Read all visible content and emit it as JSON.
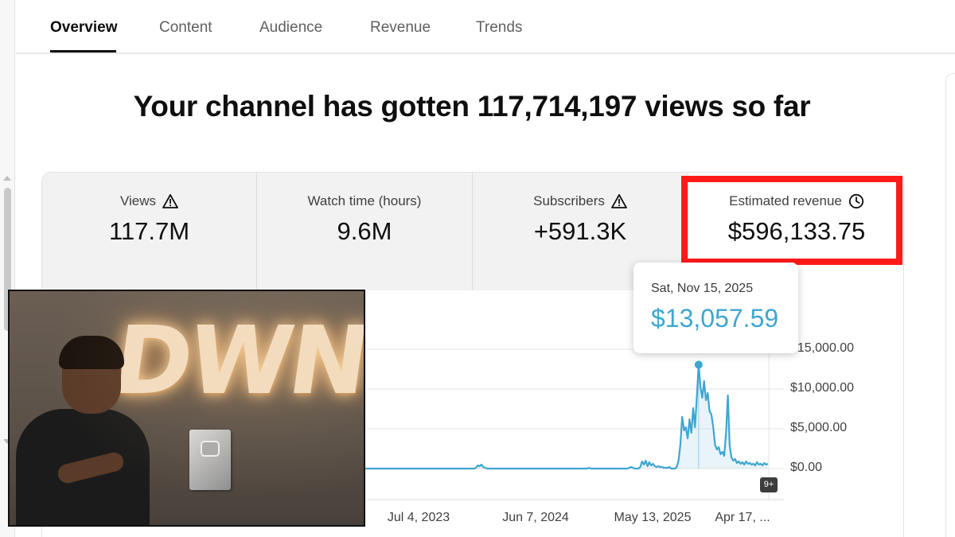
{
  "tabs": [
    {
      "label": "Overview",
      "active": true
    },
    {
      "label": "Content",
      "active": false
    },
    {
      "label": "Audience",
      "active": false
    },
    {
      "label": "Revenue",
      "active": false
    },
    {
      "label": "Trends",
      "active": false
    }
  ],
  "headline": "Your channel has gotten 117,714,197 views so far",
  "metrics": [
    {
      "label": "Views",
      "value": "117.7M",
      "icon": "warning-icon"
    },
    {
      "label": "Watch time (hours)",
      "value": "9.6M",
      "icon": ""
    },
    {
      "label": "Subscribers",
      "value": "+591.3K",
      "icon": "warning-icon"
    },
    {
      "label": "Estimated revenue",
      "value": "$596,133.75",
      "icon": "clock-icon",
      "selected": true
    }
  ],
  "tooltip": {
    "date": "Sat, Nov 15, 2025",
    "value": "$13,057.59"
  },
  "badge": "9+",
  "photo": {
    "brand_text": "DWN"
  },
  "colors": {
    "line": "#3ea6d0",
    "highlight": "#ff1a1a",
    "tab_active": "#0f0f0f"
  },
  "chart_data": {
    "type": "line",
    "title": "",
    "xlabel": "",
    "ylabel": "",
    "y_tick_labels": [
      "$15,000.00",
      "$10,000.00",
      "$5,000.00",
      "$0.00"
    ],
    "y_ticks": [
      15000,
      10000,
      5000,
      0
    ],
    "ylim": [
      0,
      15000
    ],
    "x_tick_labels": [
      "Jul 4, 2023",
      "Jun 7, 2024",
      "May 13, 2025",
      "Apr 17, ..."
    ],
    "y_axis_side": "right",
    "grid": true,
    "series": [
      {
        "values": [
          0,
          0,
          0,
          0,
          0,
          0,
          0,
          0,
          0,
          0,
          0,
          0,
          0,
          0,
          0,
          0,
          0,
          0,
          0,
          0,
          0,
          0,
          0,
          0,
          0,
          0,
          0,
          0,
          0,
          0,
          0,
          0,
          0,
          0,
          0,
          0,
          0,
          0,
          0,
          0,
          0,
          0,
          0,
          0,
          0,
          0,
          0,
          0,
          0,
          0,
          0,
          0,
          0,
          0,
          0,
          0,
          0,
          0,
          0,
          0,
          0,
          0,
          0,
          0,
          0,
          0,
          0,
          0,
          0,
          0,
          0,
          0,
          0,
          0,
          0,
          0,
          0,
          0,
          0,
          0,
          0,
          0,
          0,
          0,
          0,
          0,
          0,
          0,
          0,
          0,
          0,
          0,
          0,
          0,
          0,
          0,
          0,
          0,
          0,
          0,
          0,
          0,
          0,
          0,
          0,
          0,
          0,
          0,
          0,
          0,
          0,
          0,
          0,
          0,
          0,
          0,
          0,
          0,
          0,
          0,
          0,
          0,
          0,
          0,
          0,
          0,
          0,
          0,
          0,
          0,
          100,
          400,
          300,
          500,
          200,
          100,
          0,
          0,
          0,
          0,
          0,
          0,
          0,
          0,
          0,
          0,
          0,
          0,
          0,
          0,
          0,
          0,
          0,
          0,
          0,
          0,
          0,
          0,
          0,
          0,
          0,
          0,
          0,
          0,
          0,
          0,
          0,
          0,
          0,
          0,
          0,
          0,
          0,
          0,
          0,
          0,
          0,
          0,
          0,
          0,
          0,
          0,
          0,
          0,
          0,
          0,
          0,
          0,
          0,
          0,
          0,
          0,
          100,
          0,
          0,
          0,
          0,
          0,
          0,
          0,
          0,
          0,
          0,
          0,
          0,
          0,
          0,
          0,
          0,
          0,
          0,
          0,
          0,
          0,
          100,
          200,
          100,
          0,
          0,
          0,
          200,
          900,
          500,
          1000,
          300,
          800,
          400,
          600,
          300,
          200,
          300,
          200,
          200,
          100,
          100,
          100,
          200,
          0,
          0,
          0,
          200,
          1000,
          3000,
          6500,
          4800,
          5200,
          3800,
          6200,
          4500,
          7600,
          5200,
          9000,
          13058,
          10200,
          8900,
          11000,
          8600,
          9500,
          7200,
          6800,
          5200,
          3000,
          2400,
          2700,
          1800,
          2100,
          1600,
          4500,
          9200,
          3000,
          1400,
          1000,
          1200,
          700,
          900,
          600,
          800,
          500,
          900,
          600,
          700,
          500,
          600,
          400,
          800,
          500,
          600,
          400,
          700,
          500,
          600
        ]
      }
    ],
    "highlight_point": {
      "label": "Sat, Nov 15, 2025",
      "value": 13057.59
    }
  }
}
